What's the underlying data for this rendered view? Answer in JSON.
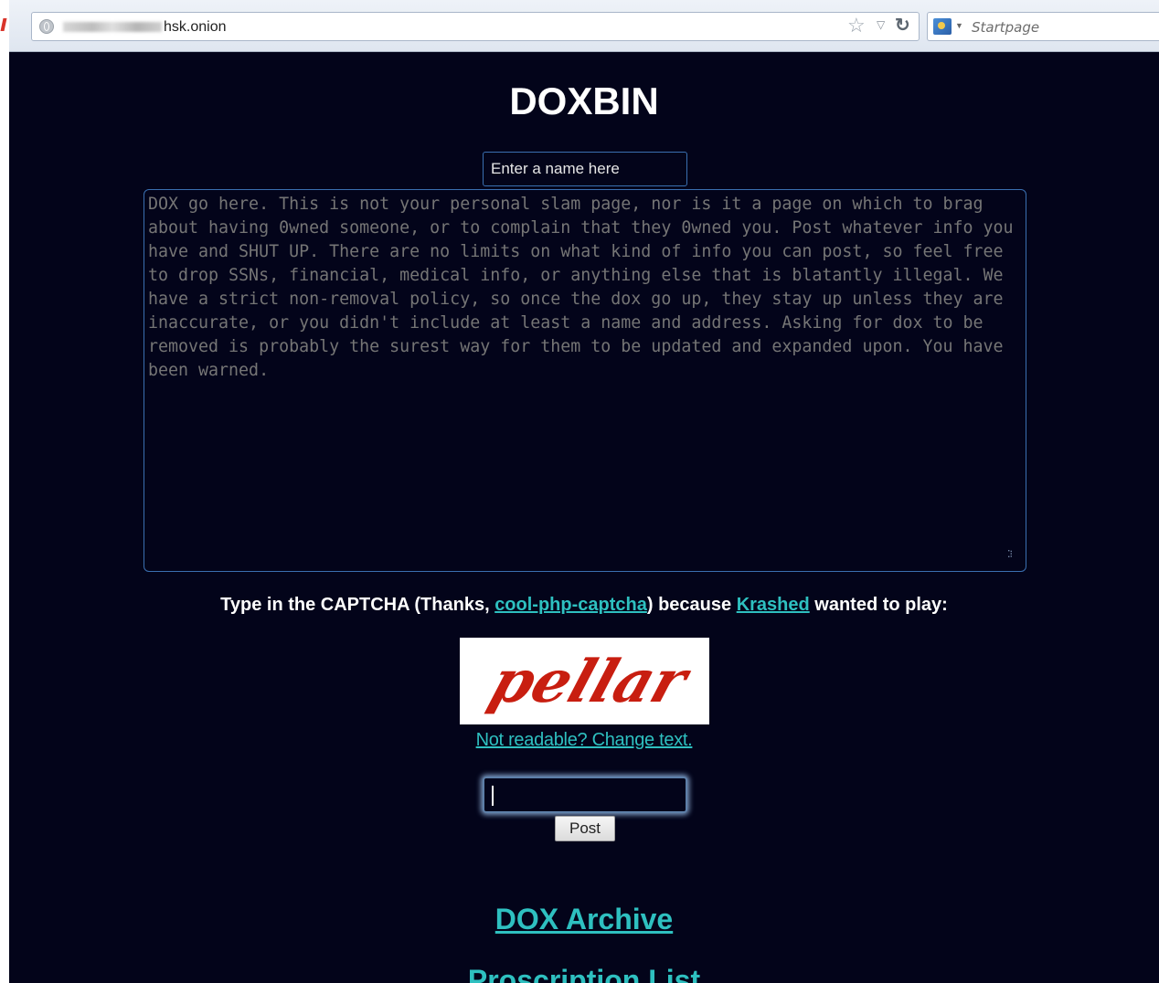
{
  "browser": {
    "url_suffix": "hsk.onion",
    "search_placeholder": "Startpage"
  },
  "page": {
    "title": "DOXBIN",
    "name_placeholder": "Enter a name here",
    "dox_placeholder": "DOX go here. This is not your personal slam page, nor is it a page on which to brag about having 0wned someone, or to complain that they 0wned you. Post whatever info you have and SHUT UP. There are no limits on what kind of info you can post, so feel free to drop SSNs, financial, medical info, or anything else that is blatantly illegal. We have a strict non-removal policy, so once the dox go up, they stay up unless they are inaccurate, or you didn't include at least a name and address. Asking for dox to be removed is probably the surest way for them to be updated and expanded upon. You have been warned.",
    "captcha": {
      "prefix": "Type in the CAPTCHA (Thanks, ",
      "link1": "cool-php-captcha",
      "middle": ") because ",
      "link2": "Krashed",
      "suffix": " wanted to play:",
      "image_text": "pellar",
      "change_text": "Not readable? Change text."
    },
    "post_label": "Post",
    "archive_label": "DOX Archive",
    "proscription_label": "Proscription List"
  },
  "colors": {
    "background": "#03041a",
    "link": "#2ec0c0",
    "captcha_text": "#c81e10"
  }
}
